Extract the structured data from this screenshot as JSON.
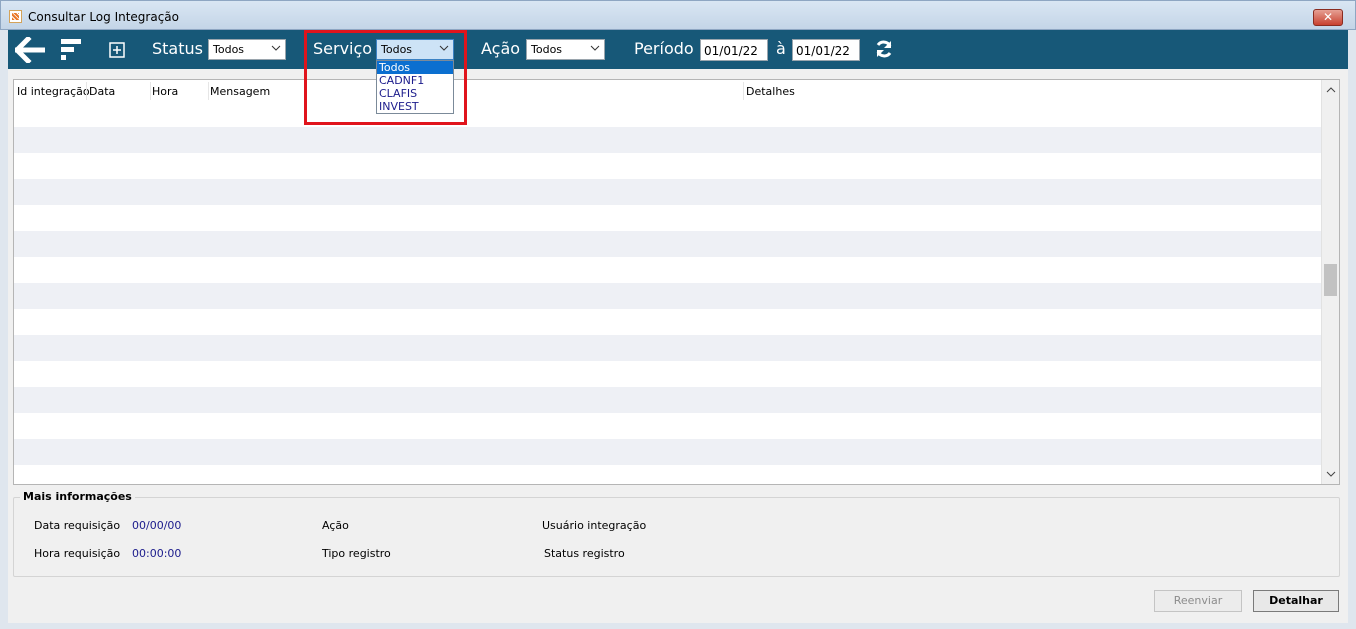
{
  "window": {
    "title": "Consultar Log Integração",
    "close_label": "✕"
  },
  "toolbar": {
    "status_label": "Status",
    "status_value": "Todos",
    "servico_label": "Serviço",
    "servico_value": "Todos",
    "acao_label": "Ação",
    "acao_value": "Todos",
    "periodo_label": "Período",
    "date_from": "01/01/22",
    "date_sep": "à",
    "date_to": "01/01/22"
  },
  "servico_dropdown": {
    "options": [
      "Todos",
      "CADNF1",
      "CLAFIS",
      "INVEST"
    ],
    "selected_index": 0
  },
  "grid": {
    "columns": [
      "Id integração",
      "Data",
      "Hora",
      "Mensagem",
      "Detalhes"
    ],
    "rows": []
  },
  "info": {
    "title": "Mais informações",
    "data_requisicao_label": "Data requisição",
    "data_requisicao_value": "00/00/00",
    "hora_requisicao_label": "Hora requisição",
    "hora_requisicao_value": "00:00:00",
    "acao_label": "Ação",
    "tipo_registro_label": "Tipo registro",
    "usuario_integracao_label": "Usuário integração",
    "status_registro_label": "Status registro"
  },
  "buttons": {
    "reenviar": "Reenviar",
    "detalhar": "Detalhar"
  },
  "colors": {
    "toolbar_bg": "#175878",
    "highlight": "#e0141c",
    "dropdown_selected": "#0b6fd0"
  }
}
